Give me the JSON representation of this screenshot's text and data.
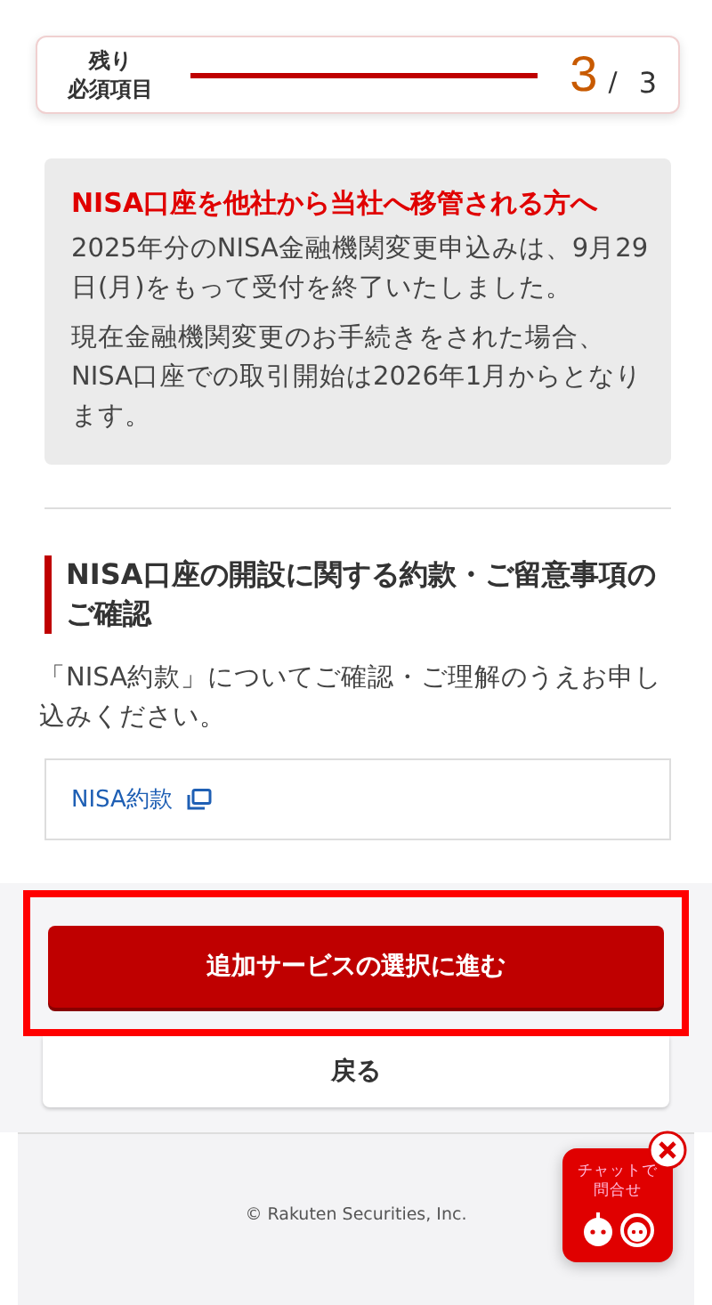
{
  "progress": {
    "label_lines": [
      "残り",
      "必須項目"
    ],
    "remaining": "3",
    "separator": "/",
    "total": "3"
  },
  "notice": {
    "title": "NISA口座を他社から当社へ移管される方へ",
    "paragraphs": [
      "2025年分のNISA金融機関変更申込みは、9月29日(月)をもって受付を終了いたしました。",
      "現在金融機関変更のお手続きをされた場合、NISA口座での取引開始は2026年1月からとなります。"
    ]
  },
  "section": {
    "heading": "NISA口座の開設に関する約款・ご留意事項のご確認",
    "body": "「NISA約款」についてご確認・ご理解のうえお申し込みください。",
    "link": "NISA約款"
  },
  "buttons": {
    "primary": "追加サービスの選択に進む",
    "primary_highlighted": true,
    "back": "戻る"
  },
  "footer": {
    "copyright": "© Rakuten Securities, Inc."
  },
  "chat": {
    "label_lines": [
      "チャットで",
      "問合せ"
    ]
  }
}
